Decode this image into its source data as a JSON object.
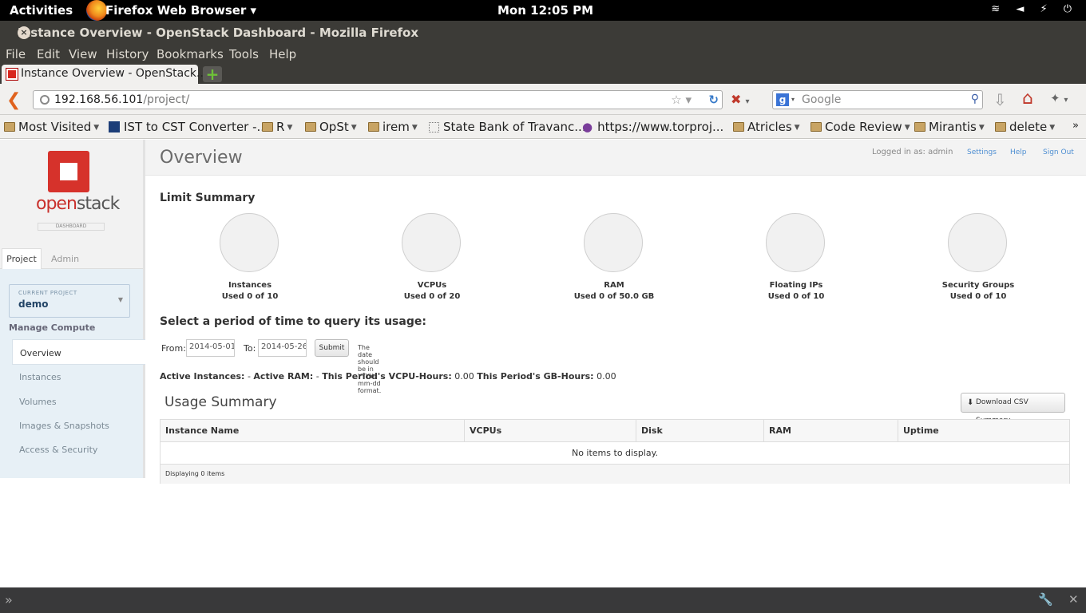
{
  "topbar": {
    "activities": "Activities",
    "app": "Firefox Web Browser ▾",
    "clock": "Mon 12:05 PM",
    "tray": "≋ ◄ ⚡ ⏻"
  },
  "window": {
    "title": "Instance Overview - OpenStack Dashboard - Mozilla Firefox",
    "close": "×"
  },
  "menu": [
    "File",
    "Edit",
    "View",
    "History",
    "Bookmarks",
    "Tools",
    "Help"
  ],
  "tab": {
    "label": "Instance Overview - OpenStack...",
    "new": "+"
  },
  "nav": {
    "url_host": "192.168.56.101",
    "url_path": "/project/",
    "search_placeholder": "Google"
  },
  "bookmarks": [
    "Most Visited",
    "IST to CST Converter -...",
    "R",
    "OpSt",
    "irem",
    "State Bank of Travanc...",
    "https://www.torproj...",
    "Atricles",
    "Code Review",
    "Mirantis",
    "delete"
  ],
  "sidebar": {
    "logo_open": "open",
    "logo_stack": "stack",
    "logo_sub": "DASHBOARD",
    "tabs": {
      "project": "Project",
      "admin": "Admin"
    },
    "current_project_caption": "CURRENT PROJECT",
    "current_project": "demo",
    "section": "Manage Compute",
    "items": [
      "Overview",
      "Instances",
      "Volumes",
      "Images & Snapshots",
      "Access & Security"
    ]
  },
  "header": {
    "title": "Overview",
    "logged_in": "Logged in as: admin",
    "settings": "Settings",
    "help": "Help",
    "signout": "Sign Out"
  },
  "limits": {
    "title": "Limit Summary",
    "items": [
      {
        "name": "Instances",
        "usage": "Used 0 of 10",
        "used": 0,
        "total": 10
      },
      {
        "name": "VCPUs",
        "usage": "Used 0 of 20",
        "used": 0,
        "total": 20
      },
      {
        "name": "RAM",
        "usage": "Used 0 of 50.0 GB",
        "used": 0,
        "total": 50
      },
      {
        "name": "Floating IPs",
        "usage": "Used 0 of 10",
        "used": 0,
        "total": 10
      },
      {
        "name": "Security Groups",
        "usage": "Used 0 of 10",
        "used": 0,
        "total": 10
      }
    ]
  },
  "query": {
    "title": "Select a period of time to query its usage:",
    "from_label": "From:",
    "from_value": "2014-05-01",
    "to_label": "To:",
    "to_value": "2014-05-26",
    "submit": "Submit",
    "hint": "The date should be in YYYY-mm-dd format."
  },
  "stats": {
    "ai_label": "Active Instances:",
    "ai_value": "-",
    "ar_label": "Active RAM:",
    "ar_value": "-",
    "vh_label": "This Period's VCPU-Hours:",
    "vh_value": "0.00",
    "gh_label": "This Period's GB-Hours:",
    "gh_value": "0.00"
  },
  "usage": {
    "title": "Usage Summary",
    "csv": "Download CSV Summary",
    "columns": [
      "Instance Name",
      "VCPUs",
      "Disk",
      "RAM",
      "Uptime"
    ],
    "empty": "No items to display.",
    "footer": "Displaying 0 items"
  }
}
